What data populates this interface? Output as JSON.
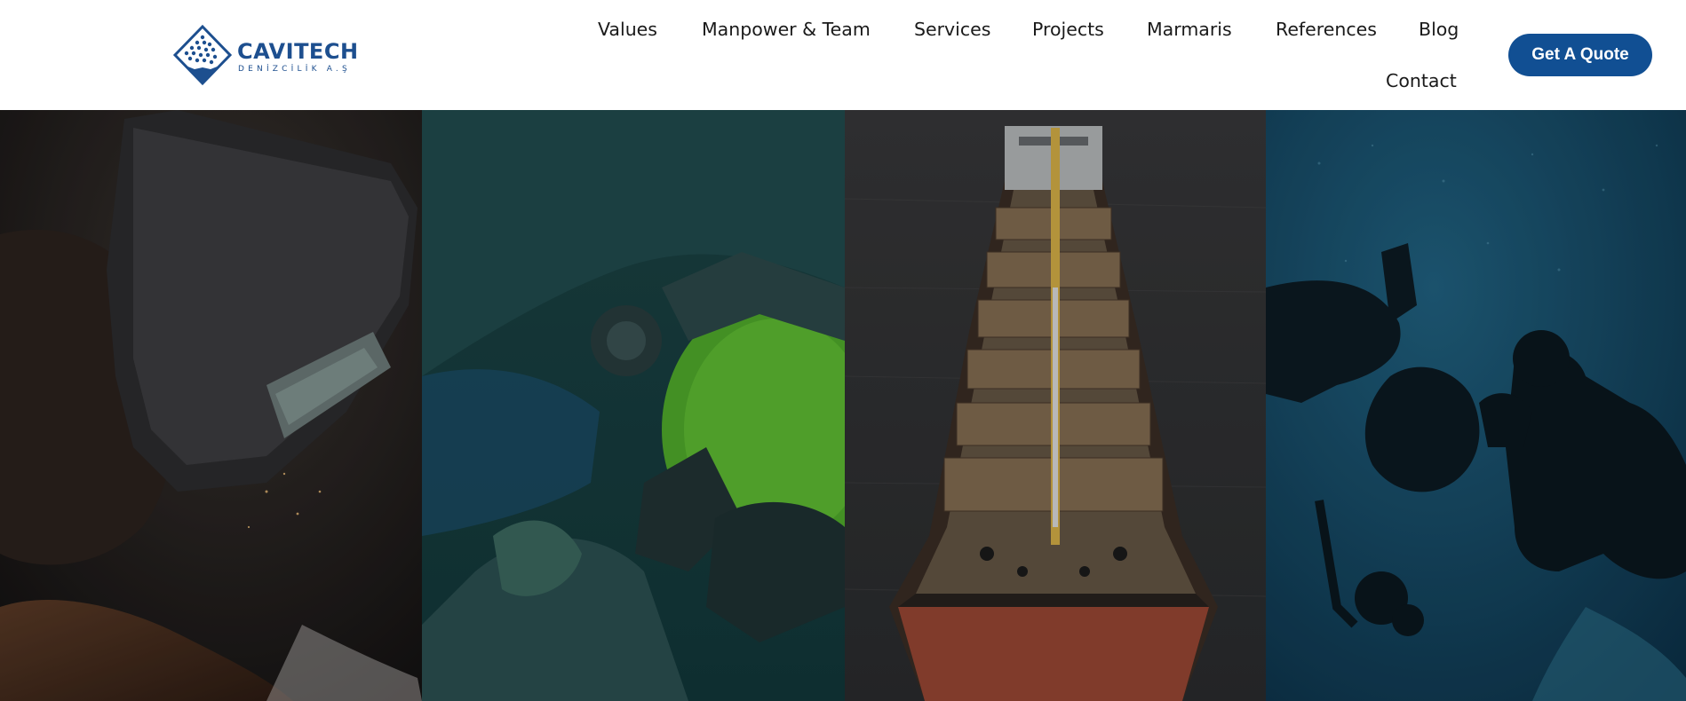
{
  "brand": {
    "name": "CAVITECH",
    "tagline": "DENİZCİLİK A.Ş",
    "accent_color": "#114f93",
    "logo_icon": "diamond-dots-logo-icon"
  },
  "nav": {
    "items": [
      {
        "label": "Values"
      },
      {
        "label": "Manpower & Team"
      },
      {
        "label": "Services"
      },
      {
        "label": "Projects"
      },
      {
        "label": "Marmaris"
      },
      {
        "label": "References"
      },
      {
        "label": "Blog"
      },
      {
        "label": "Contact"
      }
    ],
    "cta_label": "Get A Quote"
  },
  "hero": {
    "panels": [
      {
        "subject": "welder-with-mask",
        "icon": "welding-image"
      },
      {
        "subject": "diver-helmet-green",
        "icon": "diver-helmet-image"
      },
      {
        "subject": "cargo-ship-aerial",
        "icon": "ship-image"
      },
      {
        "subject": "underwater-diver-silhouette",
        "icon": "diver-image"
      }
    ]
  }
}
